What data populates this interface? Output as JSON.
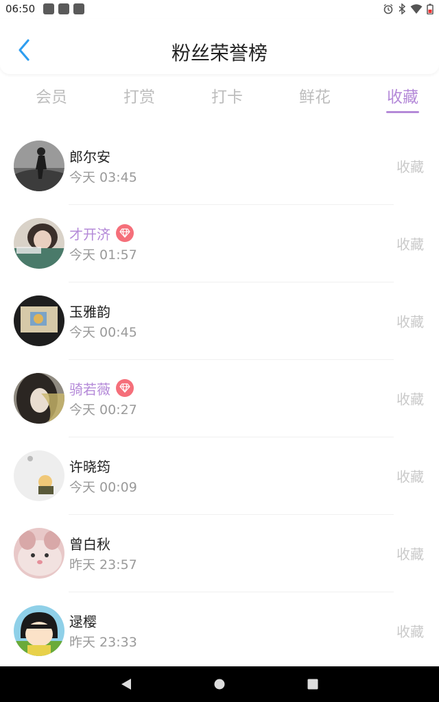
{
  "status_bar": {
    "time": "06:50",
    "icons": [
      "notification-icon",
      "notification-icon",
      "notification-icon",
      "alarm-icon",
      "bluetooth-icon",
      "wifi-icon",
      "battery-icon"
    ]
  },
  "header": {
    "title": "粉丝荣誉榜",
    "back_icon": "chevron-left-icon"
  },
  "tabs": [
    {
      "label": "会员",
      "active": false
    },
    {
      "label": "打赏",
      "active": false
    },
    {
      "label": "打卡",
      "active": false
    },
    {
      "label": "鲜花",
      "active": false
    },
    {
      "label": "收藏",
      "active": true
    }
  ],
  "colors": {
    "accent": "#b489d8",
    "vip_badge": "#f56f7a",
    "muted": "#9a9a9a",
    "action": "#c9c9c9"
  },
  "fans": [
    {
      "name": "郎尔安",
      "time": "今天 03:45",
      "vip": false,
      "action": "收藏"
    },
    {
      "name": "才开济",
      "time": "今天 01:57",
      "vip": true,
      "action": "收藏"
    },
    {
      "name": "玉雅韵",
      "time": "今天 00:45",
      "vip": false,
      "action": "收藏"
    },
    {
      "name": "骑若薇",
      "time": "今天 00:27",
      "vip": true,
      "action": "收藏"
    },
    {
      "name": "许晓筠",
      "time": "今天 00:09",
      "vip": false,
      "action": "收藏"
    },
    {
      "name": "曾白秋",
      "time": "昨天 23:57",
      "vip": false,
      "action": "收藏"
    },
    {
      "name": "逯樱",
      "time": "昨天 23:33",
      "vip": false,
      "action": "收藏"
    }
  ],
  "nav_bar": {
    "buttons": [
      "back-triangle-icon",
      "home-circle-icon",
      "recents-square-icon"
    ]
  }
}
